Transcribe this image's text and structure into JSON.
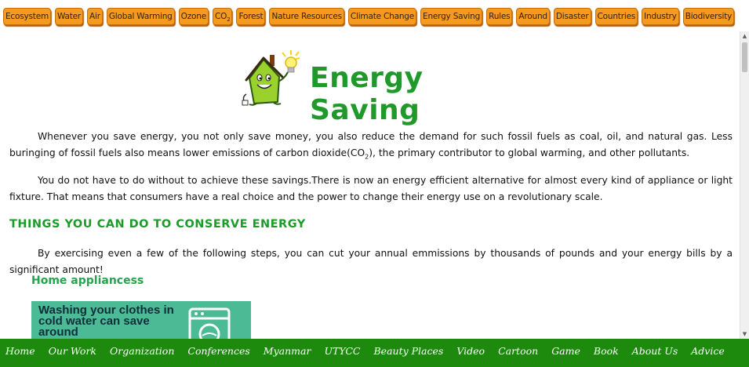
{
  "top_nav": {
    "items": [
      {
        "label": "Ecosystem"
      },
      {
        "label": "Water"
      },
      {
        "label": "Air"
      },
      {
        "label": "Global Warming"
      },
      {
        "label": "Ozone"
      },
      {
        "label": "CO",
        "sub": "2"
      },
      {
        "label": "Forest"
      },
      {
        "label": "Nature Resources"
      },
      {
        "label": "Climate Change"
      },
      {
        "label": "Energy Saving"
      },
      {
        "label": "Rules"
      },
      {
        "label": "Around"
      },
      {
        "label": "Disaster"
      },
      {
        "label": "Countries"
      },
      {
        "label": "Industry"
      },
      {
        "label": "Biodiversity"
      }
    ]
  },
  "page": {
    "title": "Energy Saving",
    "para1": {
      "before": "Whenever you save energy, you not only save money, you also reduce the demand for such fossil fuels as coal, oil, and natural gas. Less buringing of fossil fuels also means lower emissions of carbon dioxide(CO",
      "sub": "2",
      "after": "), the primary contributor to global warming, and other pollutants."
    },
    "para2": "You do not have to do without to achieve these savings.There is now an energy efficient alternative for almost every kind of appliance or light fixture. That means that consumers have a real choice and the power to change their energy use on a revolutionary scale.",
    "section_heading": "THINGS YOU CAN DO TO CONSERVE ENERGY",
    "para3": "By exercising even a few of the following steps, you can cut your annual emmissions by thousands of pounds and your energy bills by a significant amount!",
    "sub_heading": "Home appliancess",
    "tip_image_text": "Washing your clothes in cold water can save around"
  },
  "bottom_nav": {
    "items": [
      "Home",
      "Our Work",
      "Organization",
      "Conferences",
      "Myanmar",
      "UTYCC",
      "Beauty Places",
      "Video",
      "Cartoon",
      "Game",
      "Book",
      "About Us",
      "Advice"
    ]
  },
  "colors": {
    "nav_button": "#f39a1f",
    "title_green": "#1f9a2a",
    "bottom_bar": "#1d8a0e",
    "tip_background": "#4cba94"
  },
  "icons": {
    "logo": "energy-house-icon",
    "washer": "washing-machine-icon",
    "scroll_up": "arrow-up-icon",
    "scroll_down": "arrow-down-icon"
  }
}
